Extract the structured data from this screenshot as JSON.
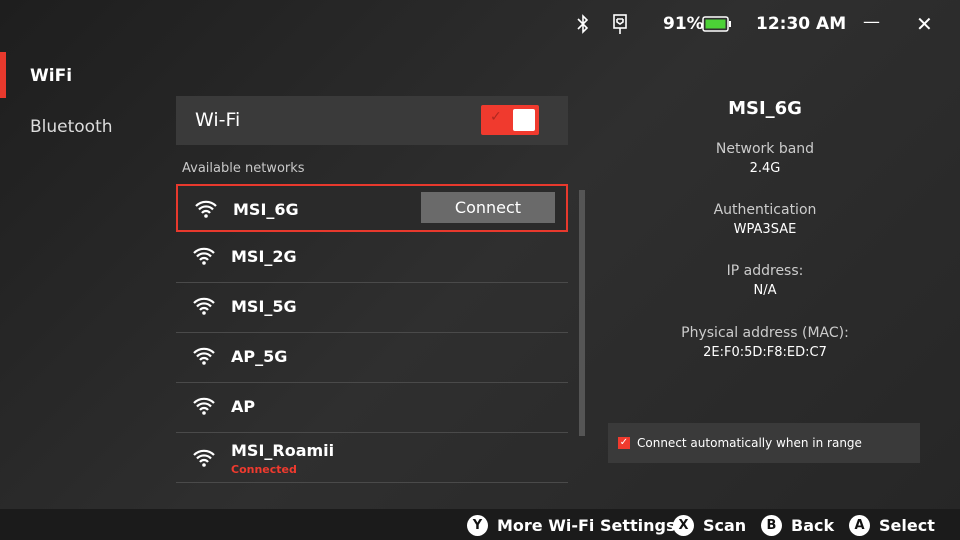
{
  "status": {
    "battery": "91%",
    "time": "12:30 AM",
    "battery_color": "#4cd137"
  },
  "sidebar": {
    "items": [
      {
        "label": "WiFi"
      },
      {
        "label": "Bluetooth"
      }
    ]
  },
  "wifi": {
    "label": "Wi-Fi",
    "enabled": true,
    "available_label": "Available networks",
    "connect_label": "Connect",
    "networks": [
      {
        "name": "MSI_6G"
      },
      {
        "name": "MSI_2G"
      },
      {
        "name": "MSI_5G"
      },
      {
        "name": "AP_5G"
      },
      {
        "name": "AP"
      },
      {
        "name": "MSI_Roamii",
        "status": "Connected"
      }
    ]
  },
  "details": {
    "title": "MSI_6G",
    "fields": [
      {
        "k": "Network band",
        "v": "2.4G"
      },
      {
        "k": "Authentication",
        "v": "WPA3SAE"
      },
      {
        "k": "IP address:",
        "v": "N/A"
      },
      {
        "k": "Physical address (MAC):",
        "v": "2E:F0:5D:F8:ED:C7"
      }
    ],
    "auto_connect": "Connect automatically when in range",
    "auto_checked": true
  },
  "hints": [
    {
      "btn": "Y",
      "label": "More Wi-Fi Settings"
    },
    {
      "btn": "X",
      "label": "Scan"
    },
    {
      "btn": "B",
      "label": "Back"
    },
    {
      "btn": "A",
      "label": "Select"
    }
  ],
  "accent": "#e8392d"
}
